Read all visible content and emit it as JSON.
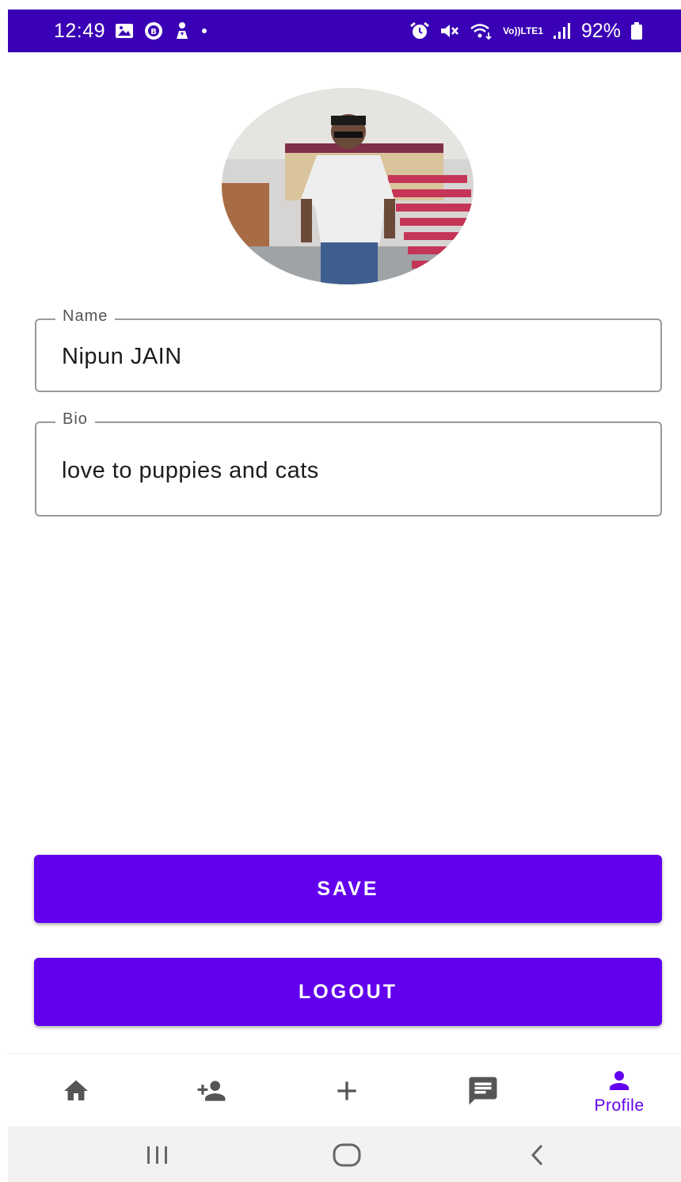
{
  "status_bar": {
    "time": "12:49",
    "battery": "92%",
    "left_icons": [
      "gallery-icon",
      "app-badge-icon",
      "download-person-icon",
      "dot-icon"
    ],
    "right_icons": [
      "alarm-icon",
      "mute-icon",
      "wifi-icon",
      "volte-icon",
      "signal-icon",
      "battery-icon"
    ],
    "volte_top": "Vo))",
    "volte_bottom": "LTE1"
  },
  "profile": {
    "avatar_alt": "profile-photo"
  },
  "form": {
    "name_label": "Name",
    "name_value": "Nipun JAIN",
    "bio_label": "Bio",
    "bio_value": "love to puppies and cats"
  },
  "buttons": {
    "save_label": "SAVE",
    "logout_label": "LOGOUT"
  },
  "bottom_nav": {
    "items": [
      {
        "icon": "home-icon",
        "label": ""
      },
      {
        "icon": "add-person-icon",
        "label": ""
      },
      {
        "icon": "plus-icon",
        "label": ""
      },
      {
        "icon": "chat-icon",
        "label": ""
      },
      {
        "icon": "person-icon",
        "label": "Profile",
        "active": true
      }
    ],
    "active_color": "#6200ee",
    "inactive_color": "#555555"
  },
  "system_nav": [
    "recents-icon",
    "home-circle-icon",
    "back-icon"
  ],
  "colors": {
    "status_bar": "#3a00b5",
    "primary": "#6200ee"
  }
}
